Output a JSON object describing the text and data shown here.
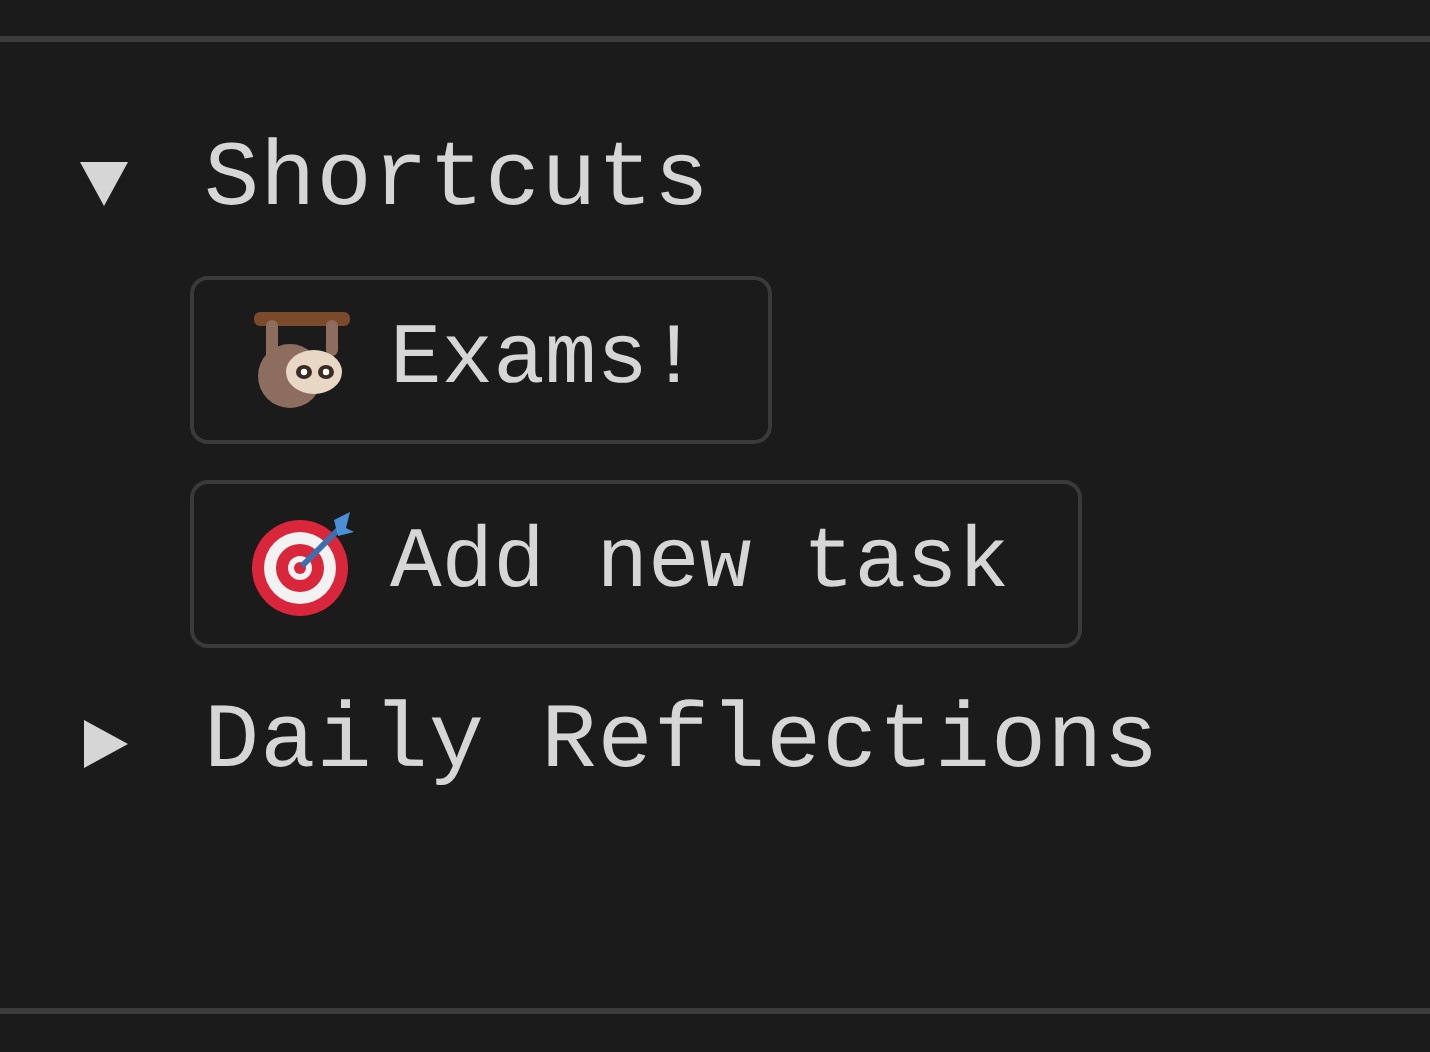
{
  "sections": [
    {
      "label": "Shortcuts",
      "expanded": true,
      "items": [
        {
          "label": "Exams!"
        },
        {
          "label": "Add new task"
        }
      ]
    },
    {
      "label": "Daily Reflections",
      "expanded": false
    }
  ]
}
